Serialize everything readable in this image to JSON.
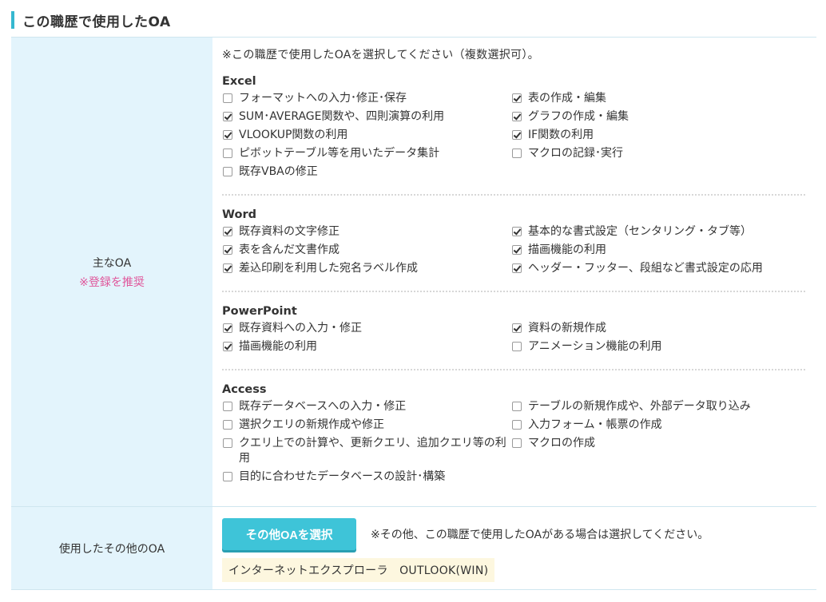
{
  "section": {
    "title": "この職歴で使用したOA"
  },
  "main_oa": {
    "label": "主なOA",
    "note": "※登録を推奨",
    "intro": "※この職歴で使用したOAを選択してください（複数選択可）。",
    "groups": [
      {
        "name": "Excel",
        "items": [
          {
            "label": "フォーマットへの入力･修正･保存",
            "checked": false
          },
          {
            "label": "表の作成・編集",
            "checked": true
          },
          {
            "label": "SUM･AVERAGE関数や、四則演算の利用",
            "checked": true
          },
          {
            "label": "グラフの作成・編集",
            "checked": true
          },
          {
            "label": "VLOOKUP関数の利用",
            "checked": true
          },
          {
            "label": "IF関数の利用",
            "checked": true
          },
          {
            "label": "ピボットテーブル等を用いたデータ集計",
            "checked": false
          },
          {
            "label": "マクロの記録･実行",
            "checked": false
          },
          {
            "label": "既存VBAの修正",
            "checked": false
          }
        ]
      },
      {
        "name": "Word",
        "items": [
          {
            "label": "既存資料の文字修正",
            "checked": true
          },
          {
            "label": "基本的な書式設定（センタリング・タブ等）",
            "checked": true
          },
          {
            "label": "表を含んだ文書作成",
            "checked": true
          },
          {
            "label": "描画機能の利用",
            "checked": true
          },
          {
            "label": "差込印刷を利用した宛名ラベル作成",
            "checked": true
          },
          {
            "label": "ヘッダー・フッター、段組など書式設定の応用",
            "checked": true
          }
        ]
      },
      {
        "name": "PowerPoint",
        "items": [
          {
            "label": "既存資料への入力・修正",
            "checked": true
          },
          {
            "label": "資料の新規作成",
            "checked": true
          },
          {
            "label": "描画機能の利用",
            "checked": true
          },
          {
            "label": "アニメーション機能の利用",
            "checked": false
          }
        ]
      },
      {
        "name": "Access",
        "items": [
          {
            "label": "既存データベースへの入力・修正",
            "checked": false
          },
          {
            "label": "テーブルの新規作成や、外部データ取り込み",
            "checked": false
          },
          {
            "label": "選択クエリの新規作成や修正",
            "checked": false
          },
          {
            "label": "入力フォーム・帳票の作成",
            "checked": false
          },
          {
            "label": "クエリ上での計算や、更新クエリ、追加クエリ等の利用",
            "checked": false
          },
          {
            "label": "マクロの作成",
            "checked": false
          },
          {
            "label": "目的に合わせたデータベースの設計･構築",
            "checked": false
          }
        ]
      }
    ]
  },
  "other_oa": {
    "label": "使用したその他のOA",
    "button_label": "その他OAを選択",
    "note": "※その他、この職歴で使用したOAがある場合は選択してください。",
    "selected": "インターネットエクスプローラ　OUTLOOK(WIN)"
  }
}
